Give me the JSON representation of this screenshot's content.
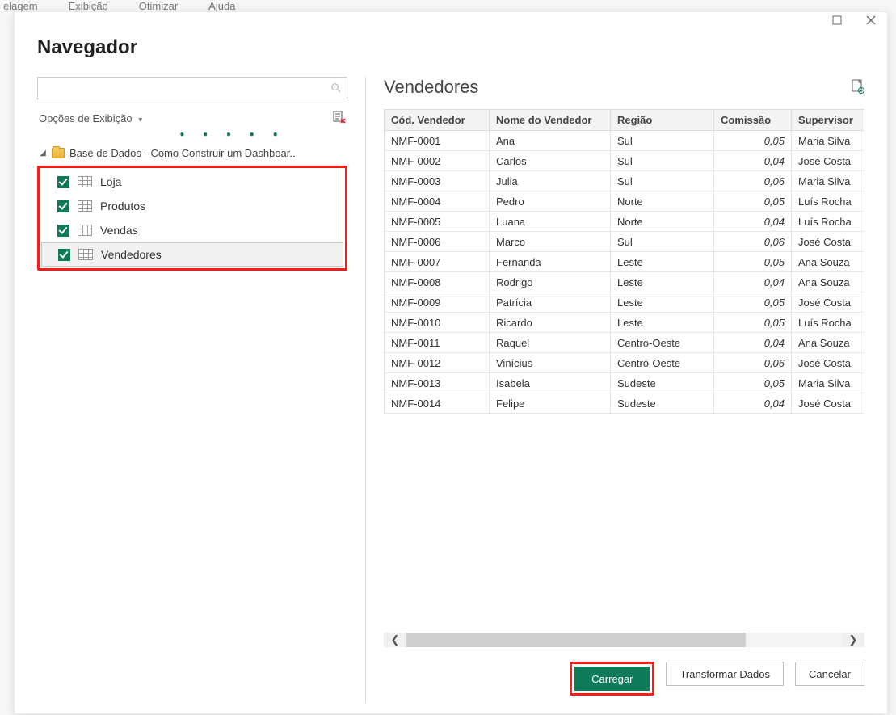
{
  "ribbon": {
    "items": [
      "elagem",
      "Exibição",
      "Otimizar",
      "Ajuda"
    ]
  },
  "dialog": {
    "title": "Navegador",
    "search_placeholder": "",
    "display_options_label": "Opções de Exibição",
    "source_name": "Base de Dados - Como Construir um Dashboar...",
    "tables": [
      {
        "name": "Loja",
        "checked": true,
        "selected": false
      },
      {
        "name": "Produtos",
        "checked": true,
        "selected": false
      },
      {
        "name": "Vendas",
        "checked": true,
        "selected": false
      },
      {
        "name": "Vendedores",
        "checked": true,
        "selected": true
      }
    ]
  },
  "preview": {
    "title": "Vendedores",
    "columns": [
      "Cód. Vendedor",
      "Nome do Vendedor",
      "Região",
      "Comissão",
      "Supervisor"
    ],
    "rows": [
      {
        "cod": "NMF-0001",
        "nome": "Ana",
        "regiao": "Sul",
        "com": "0,05",
        "sup": "Maria Silva"
      },
      {
        "cod": "NMF-0002",
        "nome": "Carlos",
        "regiao": "Sul",
        "com": "0,04",
        "sup": "José Costa"
      },
      {
        "cod": "NMF-0003",
        "nome": "Julia",
        "regiao": "Sul",
        "com": "0,06",
        "sup": "Maria Silva"
      },
      {
        "cod": "NMF-0004",
        "nome": "Pedro",
        "regiao": "Norte",
        "com": "0,05",
        "sup": "Luís Rocha"
      },
      {
        "cod": "NMF-0005",
        "nome": "Luana",
        "regiao": "Norte",
        "com": "0,04",
        "sup": "Luís Rocha"
      },
      {
        "cod": "NMF-0006",
        "nome": "Marco",
        "regiao": "Sul",
        "com": "0,06",
        "sup": "José Costa"
      },
      {
        "cod": "NMF-0007",
        "nome": "Fernanda",
        "regiao": "Leste",
        "com": "0,05",
        "sup": "Ana Souza"
      },
      {
        "cod": "NMF-0008",
        "nome": "Rodrigo",
        "regiao": "Leste",
        "com": "0,04",
        "sup": "Ana Souza"
      },
      {
        "cod": "NMF-0009",
        "nome": "Patrícia",
        "regiao": "Leste",
        "com": "0,05",
        "sup": "José Costa"
      },
      {
        "cod": "NMF-0010",
        "nome": "Ricardo",
        "regiao": "Leste",
        "com": "0,05",
        "sup": "Luís Rocha"
      },
      {
        "cod": "NMF-0011",
        "nome": "Raquel",
        "regiao": "Centro-Oeste",
        "com": "0,04",
        "sup": "Ana Souza"
      },
      {
        "cod": "NMF-0012",
        "nome": "Vinícius",
        "regiao": "Centro-Oeste",
        "com": "0,06",
        "sup": "José Costa"
      },
      {
        "cod": "NMF-0013",
        "nome": "Isabela",
        "regiao": "Sudeste",
        "com": "0,05",
        "sup": "Maria Silva"
      },
      {
        "cod": "NMF-0014",
        "nome": "Felipe",
        "regiao": "Sudeste",
        "com": "0,04",
        "sup": "José Costa"
      }
    ]
  },
  "footer": {
    "load": "Carregar",
    "transform": "Transformar Dados",
    "cancel": "Cancelar"
  }
}
